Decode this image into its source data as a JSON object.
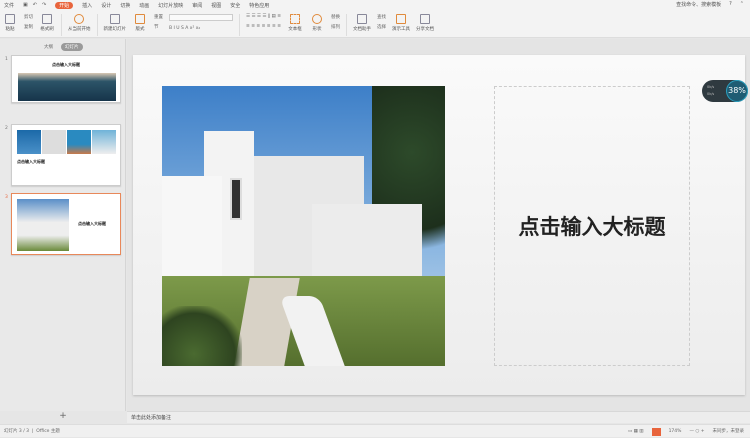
{
  "menu": {
    "file": "文件",
    "tabs": [
      "开始",
      "插入",
      "设计",
      "切换",
      "动画",
      "幻灯片放映",
      "审阅",
      "视图",
      "安全",
      "特色应用"
    ],
    "search": "查找命令、搜索模板",
    "help": "?"
  },
  "toolbar": {
    "paste": "粘贴",
    "cut": "剪切",
    "copy": "复制",
    "format_painter": "格式刷",
    "from_current": "从当前开始",
    "new_slide": "新建幻灯片",
    "layout": "版式",
    "reset": "重置",
    "section": "节",
    "textbox": "文本框",
    "shape": "形状",
    "arrange": "排列",
    "replace": "替换",
    "select": "选择",
    "doc_assistant": "文档助手",
    "find": "查找",
    "present_tools": "演示工具",
    "share": "分享文档"
  },
  "panel": {
    "tabs": [
      "大纲",
      "幻灯片"
    ],
    "slides": [
      {
        "num": "1",
        "title": "点击输入大标题"
      },
      {
        "num": "2",
        "title": "点击输入大标题"
      },
      {
        "num": "3",
        "title": "点击输入大标题"
      }
    ],
    "add": "+"
  },
  "slide": {
    "title": "点击输入大标题"
  },
  "widget": {
    "percent": "38%",
    "up": "0k/s",
    "down": "0k/s"
  },
  "notes": {
    "placeholder": "单击此处添加备注"
  },
  "status": {
    "slide_info": "幻灯片 3 / 3",
    "theme": "Office 主题",
    "zoom": "174%",
    "sync": "未同步，未登录"
  },
  "colors": {
    "accent": "#e8643c"
  }
}
